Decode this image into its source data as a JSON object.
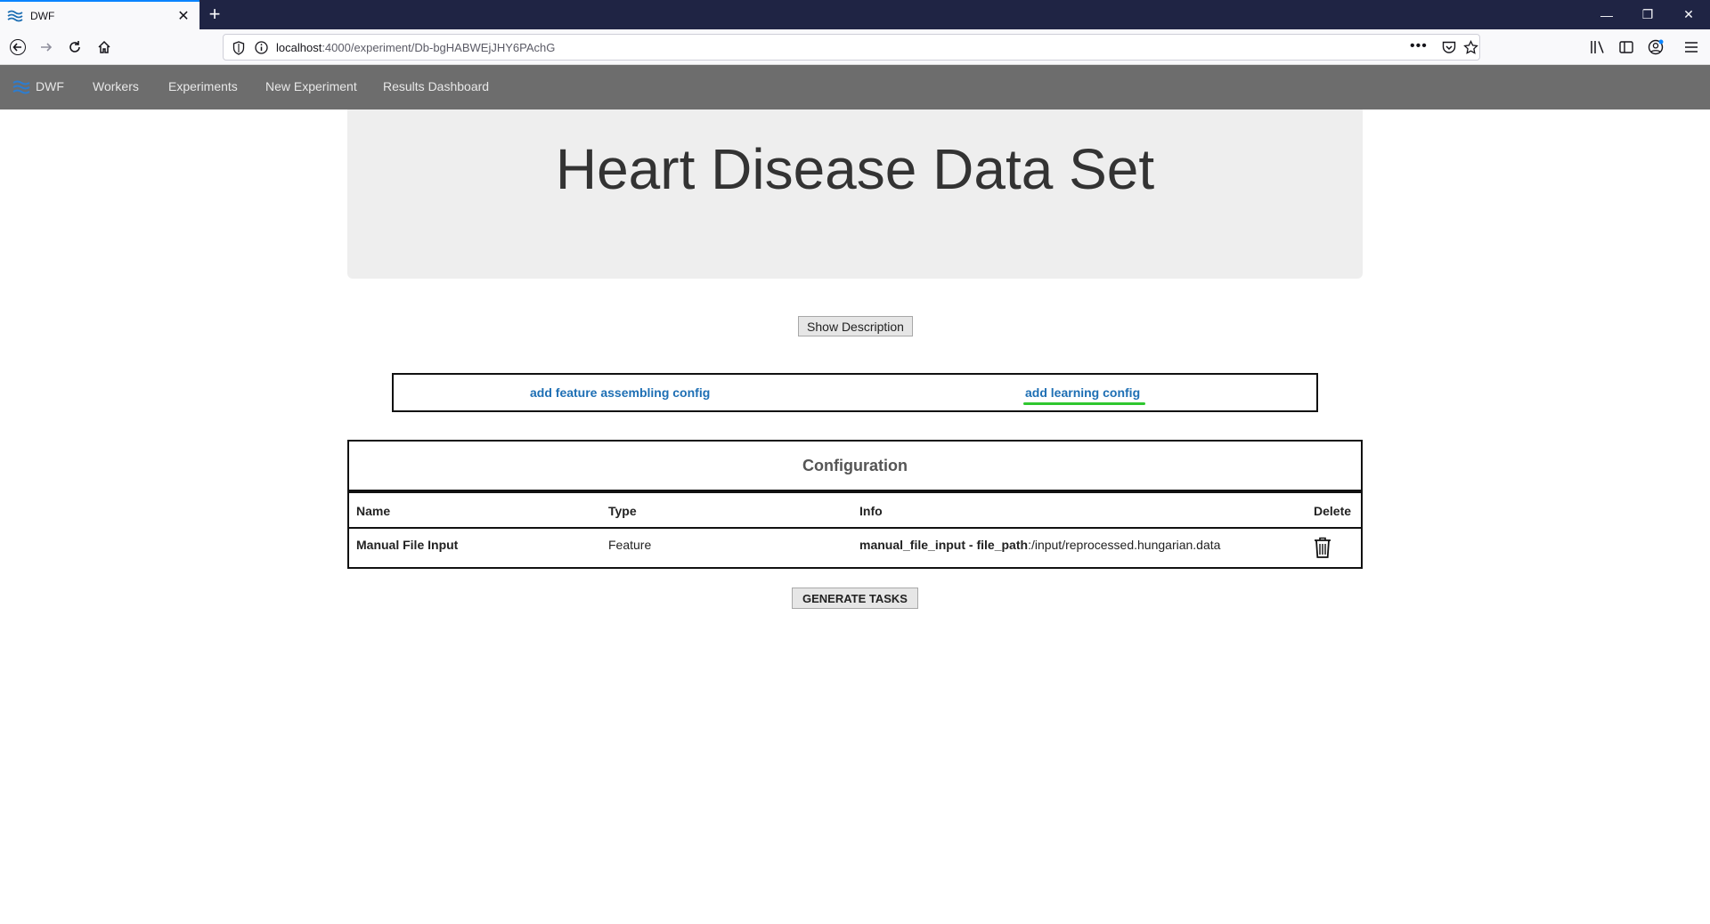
{
  "browser": {
    "tab_title": "DWF",
    "url_host": "localhost",
    "url_path": ":4000/experiment/Db-bgHABWEjJHY6PAchG",
    "colors": {
      "tabbar": "#1f2444",
      "active_tab_border": "#0a84ff"
    }
  },
  "appnav": {
    "brand": "DWF",
    "items": [
      {
        "label": "Workers"
      },
      {
        "label": "Experiments"
      },
      {
        "label": "New Experiment"
      },
      {
        "label": "Results Dashboard"
      }
    ]
  },
  "hero": {
    "title": "Heart Disease Data Set"
  },
  "show_description_label": "Show Description",
  "config_links": {
    "feature": "add feature assembling config",
    "learning": "add learning config",
    "active_underline_color": "#2fc72f"
  },
  "configuration": {
    "title": "Configuration",
    "columns": {
      "name": "Name",
      "type": "Type",
      "info": "Info",
      "delete": "Delete"
    },
    "rows": [
      {
        "name": "Manual File Input",
        "type": "Feature",
        "info_key": "manual_file_input",
        "info_sep": " - ",
        "info_param": "file_path",
        "info_value": ":/input/reprocessed.hungarian.data"
      }
    ]
  },
  "generate_tasks_label": "GENERATE TASKS",
  "icons": [
    "dwf-logo-icon",
    "close-icon",
    "plus-icon",
    "back-arrow-icon",
    "forward-arrow-icon",
    "reload-icon",
    "home-icon",
    "shield-icon",
    "info-icon",
    "more-icon",
    "pocket-icon",
    "star-icon",
    "library-icon",
    "sidebar-icon",
    "account-icon",
    "menu-icon",
    "trash-icon"
  ]
}
